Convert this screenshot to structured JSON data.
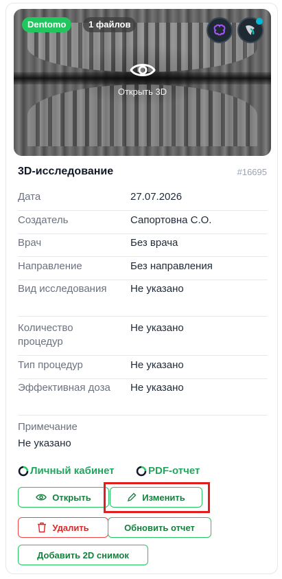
{
  "preview": {
    "brand_badge": "Dentomo",
    "files_badge": "1 файлов",
    "open_3d_label": "Открыть 3D",
    "icons": [
      "brain-ai-icon",
      "tooth-app-icon",
      "eye-icon"
    ]
  },
  "study": {
    "title": "3D-исследование",
    "id": "#16695",
    "fields": [
      {
        "label": "Дата",
        "value": "27.07.2026"
      },
      {
        "label": "Создатель",
        "value": "Сапортовна С.О."
      },
      {
        "label": "Врач",
        "value": "Без врача"
      },
      {
        "label": "Направление",
        "value": "Без направления"
      },
      {
        "label": "Вид исследования",
        "value": "Не указано"
      },
      {
        "label": "Количество процедур",
        "value": "Не указано"
      },
      {
        "label": "Тип процедур",
        "value": "Не указано"
      },
      {
        "label": "Эффективная доза",
        "value": "Не указано"
      }
    ],
    "note_label": "Примечание",
    "note_value": "Не указано"
  },
  "links": {
    "cabinet": "Личный кабинет",
    "pdf": "PDF-отчет"
  },
  "actions": {
    "open": "Открыть",
    "edit": "Изменить",
    "delete": "Удалить",
    "update_report": "Обновить отчет",
    "add_2d": "Добавить 2D снимок"
  },
  "colors": {
    "accent": "#22c55e",
    "danger": "#ef4444",
    "highlight": "#e11d1d"
  }
}
